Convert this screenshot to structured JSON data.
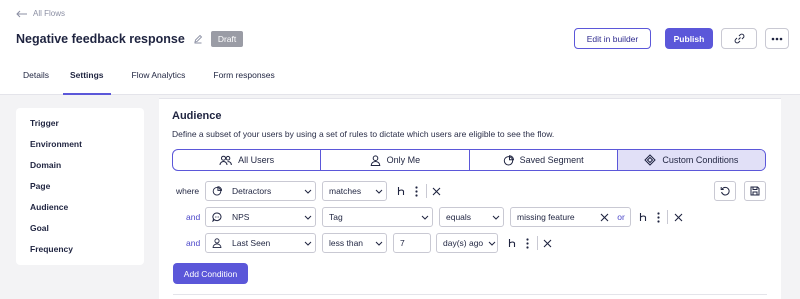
{
  "header": {
    "back_label": "All Flows",
    "title": "Negative feedback response",
    "status_badge": "Draft",
    "edit_label": "Edit in builder",
    "publish_label": "Publish"
  },
  "tabs": [
    {
      "label": "Details",
      "active": false
    },
    {
      "label": "Settings",
      "active": true
    },
    {
      "label": "Flow Analytics",
      "active": false
    },
    {
      "label": "Form responses",
      "active": false
    }
  ],
  "sidebar": {
    "items": [
      "Trigger",
      "Environment",
      "Domain",
      "Page",
      "Audience",
      "Goal",
      "Frequency"
    ]
  },
  "audience": {
    "title": "Audience",
    "description": "Define a subset of your users by using a set of rules to dictate which users are eligible to see the flow.",
    "segments": [
      {
        "label": "All Users",
        "icon": "users-icon",
        "active": false
      },
      {
        "label": "Only Me",
        "icon": "user-icon",
        "active": false
      },
      {
        "label": "Saved Segment",
        "icon": "pie-chart-icon",
        "active": false
      },
      {
        "label": "Custom Conditions",
        "icon": "diamond-icon",
        "active": true
      }
    ],
    "conditions": [
      {
        "connector": "where",
        "field": "Detractors",
        "field_icon": "pie-chart-icon",
        "operator": "matches"
      },
      {
        "connector": "and",
        "field": "NPS",
        "field_icon": "chat-bubble-icon",
        "type": "Tag",
        "operator": "equals",
        "value": "missing feature",
        "or_label": "or"
      },
      {
        "connector": "and",
        "field": "Last Seen",
        "field_icon": "user-icon",
        "operator": "less than",
        "value": "7",
        "unit": "day(s) ago"
      }
    ],
    "add_condition_label": "Add Condition"
  },
  "colors": {
    "accent": "#5b57d9",
    "accent_light": "#e1e0f7",
    "badge": "#9a9ca5",
    "link": "#4b47c9"
  }
}
